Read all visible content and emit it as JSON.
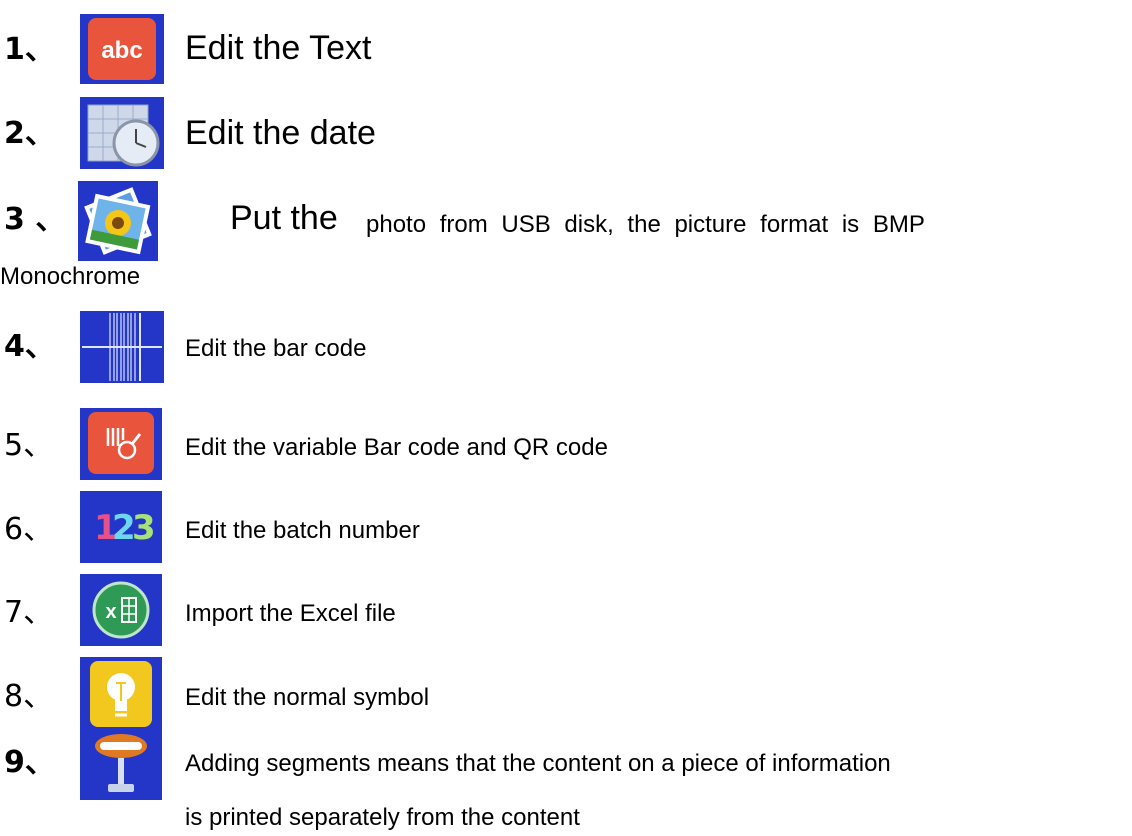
{
  "items": [
    {
      "num": "1、",
      "text": "Edit the Text",
      "icon": "abc-text-icon"
    },
    {
      "num": "2、",
      "text": "Edit the date",
      "icon": "calendar-clock-icon"
    },
    {
      "num": "3 、",
      "text_lead": "Put the",
      "text_rest": "photo from USB disk, the picture format is BMP",
      "text_cont": "Monochrome",
      "icon": "sunflower-photo-icon"
    },
    {
      "num": "4、",
      "text": "Edit the bar code",
      "icon": "barcode-lines-icon"
    },
    {
      "num": "5、",
      "text": "Edit the variable Bar code and QR code",
      "icon": "variable-barcode-icon"
    },
    {
      "num": "6、",
      "text": "Edit the batch number",
      "icon": "number-123-icon"
    },
    {
      "num": "7、",
      "text": "Import the Excel file",
      "icon": "excel-icon"
    },
    {
      "num": "8、",
      "text": "Edit the normal symbol",
      "icon": "lightbulb-icon"
    },
    {
      "num": "9、",
      "text": "Adding segments means that the content on a piece of information",
      "text_cont": "is printed separately from the content",
      "icon": "segment-lamp-icon"
    }
  ],
  "icon_text": {
    "abc": "abc",
    "excel_x": "x",
    "num_1": "1",
    "num_2": "2",
    "num_3": "3"
  }
}
